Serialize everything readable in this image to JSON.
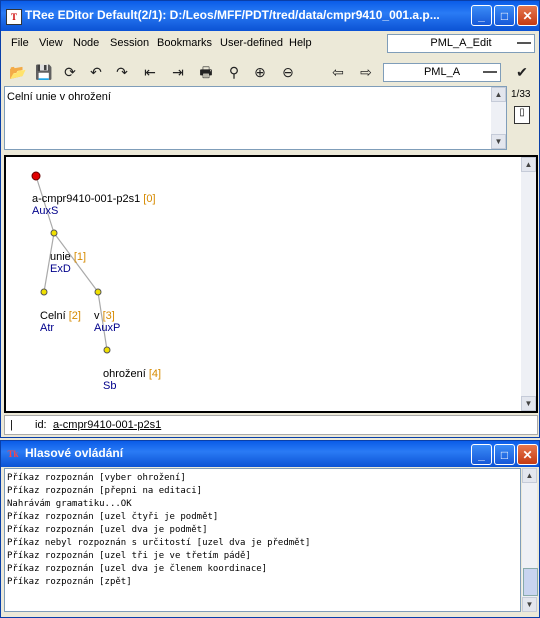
{
  "main_window": {
    "title": "TRee EDitor    Default(2/1): D:/Leos/MFF/PDT/tred/data/cmpr9410_001.a.p...",
    "menu": [
      "File",
      "View",
      "Node",
      "Session",
      "Bookmarks",
      "User-defined",
      "Help"
    ],
    "menu_combo": "PML_A_Edit",
    "toolbar_combo": "PML_A",
    "text_content": "Celní unie v ohrožení",
    "page_counter": "1/33",
    "status_label": "id:",
    "status_value": "a-cmpr9410-001-p2s1"
  },
  "tree": {
    "nodes": [
      {
        "name": "a-cmpr9410-001-p2s1",
        "ord": "[0]",
        "afun": "AuxS"
      },
      {
        "name": "unie",
        "ord": "[1]",
        "afun": "ExD"
      },
      {
        "name": "Celní",
        "ord": "[2]",
        "afun": "Atr"
      },
      {
        "name": "v",
        "ord": "[3]",
        "afun": "AuxP"
      },
      {
        "name": "ohrožení",
        "ord": "[4]",
        "afun": "Sb"
      }
    ]
  },
  "voice_window": {
    "title": "Hlasové ovládání",
    "icon_label": "Tk",
    "log": [
      "Příkaz rozpoznán [vyber ohrožení]",
      "Příkaz rozpoznán [přepni na editaci]",
      "Nahrávám gramatiku...OK",
      "Příkaz rozpoznán [uzel čtyři je podmět]",
      "Příkaz rozpoznán [uzel dva je podmět]",
      "Příkaz nebyl rozpoznán s určitostí [uzel dva je předmět]",
      "Příkaz rozpoznán [uzel tři je ve třetím pádě]",
      "Příkaz rozpoznán [uzel dva je členem koordinace]",
      "Příkaz rozpoznán [zpět]"
    ]
  },
  "colors": {
    "titlebar": "#0a5ce8",
    "root_node": "#e00000",
    "node": "#f0e000",
    "ord": "#d68a00",
    "afun": "#00008b"
  }
}
